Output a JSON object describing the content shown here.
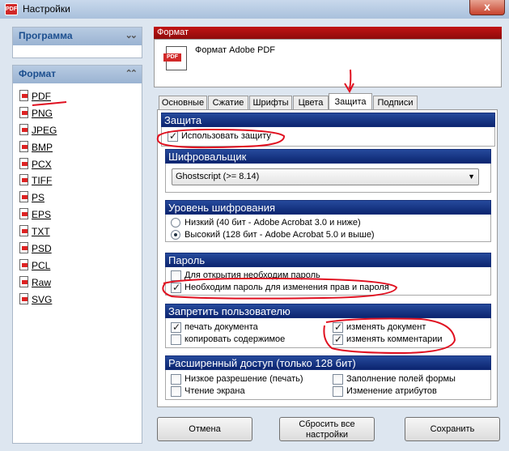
{
  "window": {
    "title": "Настройки",
    "close_glyph": "x"
  },
  "sidebar": {
    "program_header": "Программа",
    "format_header": "Формат",
    "formats": [
      "PDF",
      "PNG",
      "JPEG",
      "BMP",
      "PCX",
      "TIFF",
      "PS",
      "EPS",
      "TXT",
      "PSD",
      "PCL",
      "Raw",
      "SVG"
    ]
  },
  "main": {
    "format_section_header": "Формат",
    "format_name": "Формат Adobe PDF",
    "format_icon_label": "PDF",
    "tabs": [
      "Основные",
      "Сжатие",
      "Шрифты",
      "Цвета",
      "Защита",
      "Подписи"
    ],
    "active_tab": "Защита"
  },
  "security": {
    "header": "Защита",
    "use_security": {
      "label": "Использовать защиту",
      "checked": true
    },
    "encryptor": {
      "header": "Шифровальщик",
      "selected": "Ghostscript (>= 8.14)"
    },
    "level": {
      "header": "Уровень шифрования",
      "options": [
        {
          "label": "Низкий (40 бит - Adobe Acrobat 3.0 и ниже)",
          "checked": false
        },
        {
          "label": "Высокий (128 бит - Adobe Acrobat 5.0 и выше)",
          "checked": true
        }
      ]
    },
    "password": {
      "header": "Пароль",
      "open_password": {
        "label": "Для открытия необходим пароль",
        "checked": false
      },
      "rights_password": {
        "label": "Необходим пароль для изменения прав и пароля",
        "checked": true
      }
    },
    "restrict": {
      "header": "Запретить пользователю",
      "print": {
        "label": "печать документа",
        "checked": true
      },
      "copy": {
        "label": "копировать содержимое",
        "checked": false
      },
      "modify": {
        "label": "изменять документ",
        "checked": true
      },
      "comments": {
        "label": "изменять комментарии",
        "checked": true
      }
    },
    "extended": {
      "header": "Расширенный доступ (только 128 бит)",
      "low_res": {
        "label": "Низкое разрешение (печать)",
        "checked": false
      },
      "screen_read": {
        "label": "Чтение экрана",
        "checked": false
      },
      "fill_forms": {
        "label": "Заполнение полей формы",
        "checked": false
      },
      "change_attrs": {
        "label": "Изменение атрибутов",
        "checked": false
      }
    }
  },
  "buttons": {
    "cancel": "Отмена",
    "reset_line1": "Сбросить все",
    "reset_line2": "настройки",
    "save": "Сохранить"
  },
  "colors": {
    "annotation": "#e01020",
    "group_header": "#1a3a8c",
    "red_header": "#b01010"
  }
}
